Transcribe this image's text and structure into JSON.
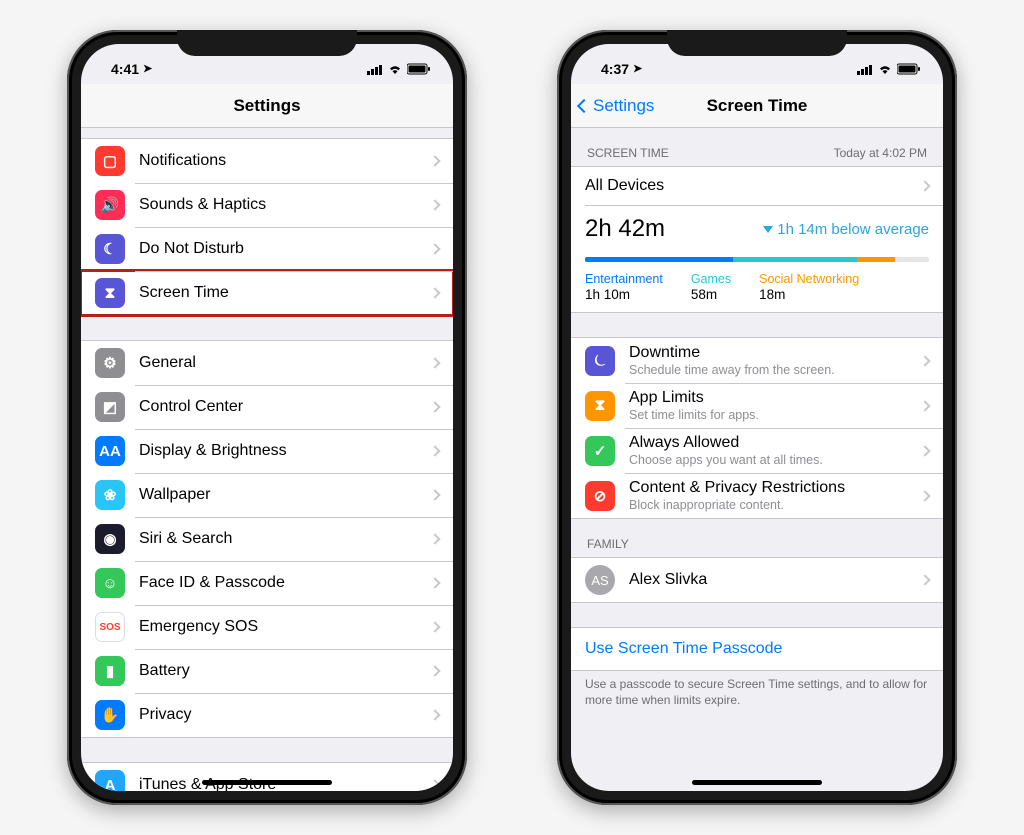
{
  "left": {
    "time": "4:41",
    "title": "Settings",
    "group1": [
      {
        "label": "Notifications",
        "icon": "notification-icon",
        "color": "#ff3b30",
        "glyph": "▢"
      },
      {
        "label": "Sounds & Haptics",
        "icon": "sound-icon",
        "color": "#ff2d55",
        "glyph": "🔊"
      },
      {
        "label": "Do Not Disturb",
        "icon": "dnd-icon",
        "color": "#5856d6",
        "glyph": "☾"
      },
      {
        "label": "Screen Time",
        "icon": "screentime-icon",
        "color": "#5856d6",
        "glyph": "⧗",
        "highlight": true
      }
    ],
    "group2": [
      {
        "label": "General",
        "icon": "gear-icon",
        "color": "#8e8e93",
        "glyph": "⚙"
      },
      {
        "label": "Control Center",
        "icon": "control-center-icon",
        "color": "#8e8e93",
        "glyph": "◩"
      },
      {
        "label": "Display & Brightness",
        "icon": "display-icon",
        "color": "#007aff",
        "glyph": "AA"
      },
      {
        "label": "Wallpaper",
        "icon": "wallpaper-icon",
        "color": "#29c5f6",
        "glyph": "❀"
      },
      {
        "label": "Siri & Search",
        "icon": "siri-icon",
        "color": "#1b1b2e",
        "glyph": "◉"
      },
      {
        "label": "Face ID & Passcode",
        "icon": "faceid-icon",
        "color": "#34c759",
        "glyph": "☺"
      },
      {
        "label": "Emergency SOS",
        "icon": "sos-icon",
        "color": "#ffffff",
        "glyph": "SOS",
        "text": "#ff3b30"
      },
      {
        "label": "Battery",
        "icon": "battery-icon",
        "color": "#34c759",
        "glyph": "▮"
      },
      {
        "label": "Privacy",
        "icon": "privacy-icon",
        "color": "#007aff",
        "glyph": "✋"
      }
    ],
    "group3": [
      {
        "label": "iTunes & App Store",
        "icon": "appstore-icon",
        "color": "#1fa7ff",
        "glyph": "A"
      }
    ]
  },
  "right": {
    "time": "4:37",
    "back": "Settings",
    "title": "Screen Time",
    "section_header": "SCREEN TIME",
    "updated": "Today at 4:02 PM",
    "all_devices": "All Devices",
    "total": "2h 42m",
    "delta": "1h 14m below average",
    "categories": [
      {
        "name": "Entertainment",
        "val": "1h 10m",
        "color": "#007aff",
        "pct": 43
      },
      {
        "name": "Games",
        "val": "58m",
        "color": "#29c5d6",
        "pct": 36
      },
      {
        "name": "Social Networking",
        "val": "18m",
        "color": "#ff9500",
        "pct": 11
      }
    ],
    "options": [
      {
        "label": "Downtime",
        "sub": "Schedule time away from the screen.",
        "icon": "downtime-icon",
        "color": "#5856d6",
        "glyph": "⏾"
      },
      {
        "label": "App Limits",
        "sub": "Set time limits for apps.",
        "icon": "applimits-icon",
        "color": "#ff9500",
        "glyph": "⧗"
      },
      {
        "label": "Always Allowed",
        "sub": "Choose apps you want at all times.",
        "icon": "always-allowed-icon",
        "color": "#34c759",
        "glyph": "✓"
      },
      {
        "label": "Content & Privacy Restrictions",
        "sub": "Block inappropriate content.",
        "icon": "restrictions-icon",
        "color": "#ff3b30",
        "glyph": "⊘"
      }
    ],
    "family_header": "FAMILY",
    "family_initials": "AS",
    "family_name": "Alex Slivka",
    "link": "Use Screen Time Passcode",
    "footer": "Use a passcode to secure Screen Time settings, and to allow for more time when limits expire."
  }
}
